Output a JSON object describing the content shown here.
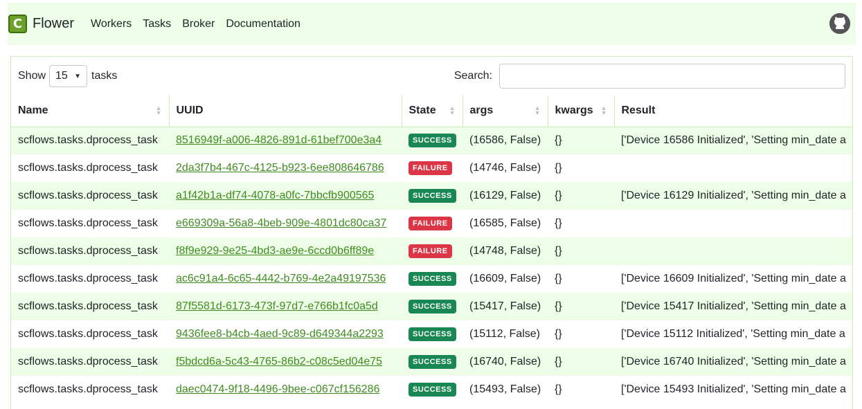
{
  "nav": {
    "brand": "Flower",
    "brand_letter": "C",
    "links": [
      "Workers",
      "Tasks",
      "Broker",
      "Documentation"
    ]
  },
  "controls": {
    "show_label": "Show",
    "page_size": "15",
    "tasks_label": "tasks",
    "search_label": "Search:"
  },
  "columns": [
    "Name",
    "UUID",
    "State",
    "args",
    "kwargs",
    "Result"
  ],
  "colors": {
    "success": "#198754",
    "failure": "#dc3545",
    "accent": "#3e8d1e",
    "stripe": "#eefde8"
  },
  "rows": [
    {
      "name": "scflows.tasks.dprocess_task",
      "uuid": "8516949f-a006-4826-891d-61bef700e3a4",
      "state": "SUCCESS",
      "args": "(16586, False)",
      "kwargs": "{}",
      "result": "['Device 16586 Initialized', 'Setting min_date a"
    },
    {
      "name": "scflows.tasks.dprocess_task",
      "uuid": "2da3f7b4-467c-4125-b923-6ee808646786",
      "state": "FAILURE",
      "args": "(14746, False)",
      "kwargs": "{}",
      "result": ""
    },
    {
      "name": "scflows.tasks.dprocess_task",
      "uuid": "a1f42b1a-df74-4078-a0fc-7bbcfb900565",
      "state": "SUCCESS",
      "args": "(16129, False)",
      "kwargs": "{}",
      "result": "['Device 16129 Initialized', 'Setting min_date a"
    },
    {
      "name": "scflows.tasks.dprocess_task",
      "uuid": "e669309a-56a8-4beb-909e-4801dc80ca37",
      "state": "FAILURE",
      "args": "(16585, False)",
      "kwargs": "{}",
      "result": ""
    },
    {
      "name": "scflows.tasks.dprocess_task",
      "uuid": "f8f9e929-9e25-4bd3-ae9e-6ccd0b6ff89e",
      "state": "FAILURE",
      "args": "(14748, False)",
      "kwargs": "{}",
      "result": ""
    },
    {
      "name": "scflows.tasks.dprocess_task",
      "uuid": "ac6c91a4-6c65-4442-b769-4e2a49197536",
      "state": "SUCCESS",
      "args": "(16609, False)",
      "kwargs": "{}",
      "result": "['Device 16609 Initialized', 'Setting min_date a"
    },
    {
      "name": "scflows.tasks.dprocess_task",
      "uuid": "87f5581d-6173-473f-97d7-e766b1fc0a5d",
      "state": "SUCCESS",
      "args": "(15417, False)",
      "kwargs": "{}",
      "result": "['Device 15417 Initialized', 'Setting min_date a"
    },
    {
      "name": "scflows.tasks.dprocess_task",
      "uuid": "9436fee8-b4cb-4aed-9c89-d649344a2293",
      "state": "SUCCESS",
      "args": "(15112, False)",
      "kwargs": "{}",
      "result": "['Device 15112 Initialized', 'Setting min_date a"
    },
    {
      "name": "scflows.tasks.dprocess_task",
      "uuid": "f5bdcd6a-5c43-4765-86b2-c08c5ed04e75",
      "state": "SUCCESS",
      "args": "(16740, False)",
      "kwargs": "{}",
      "result": "['Device 16740 Initialized', 'Setting min_date a"
    },
    {
      "name": "scflows.tasks.dprocess_task",
      "uuid": "daec0474-9f18-4496-9bee-c067cf156286",
      "state": "SUCCESS",
      "args": "(15493, False)",
      "kwargs": "{}",
      "result": "['Device 15493 Initialized', 'Setting min_date a"
    }
  ]
}
